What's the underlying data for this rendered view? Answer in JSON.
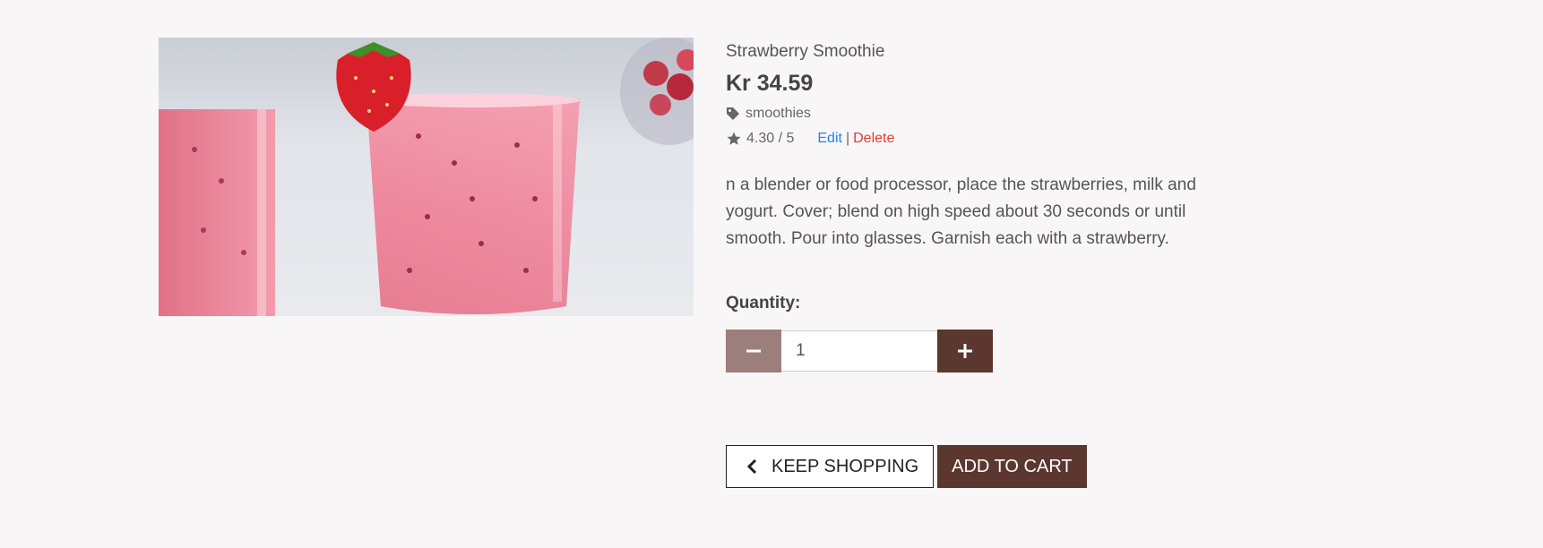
{
  "product": {
    "name": "Strawberry Smoothie",
    "price": "Kr 34.59",
    "category": "smoothies",
    "rating": "4.30 / 5",
    "edit_label": "Edit",
    "separator": "|",
    "delete_label": "Delete",
    "description": "n a blender or food processor, place the strawberries, milk and yogurt. Cover; blend on high speed about 30 seconds or until smooth. Pour into glasses. Garnish each with a strawberry."
  },
  "quantity": {
    "label": "Quantity:",
    "value": "1"
  },
  "actions": {
    "keep_shopping_label": "KEEP SHOPPING",
    "add_to_cart_label": "ADD TO CART"
  },
  "colors": {
    "background": "#f9f6f7",
    "brand_brown": "#5c372f",
    "muted_brown": "#9c7f7b",
    "edit_link": "#1e88e5",
    "delete_link": "#e53935"
  },
  "icons": {
    "category": "tag-icon",
    "rating": "star-icon",
    "decrement": "minus-icon",
    "increment": "plus-icon",
    "back": "chevron-left-icon"
  }
}
